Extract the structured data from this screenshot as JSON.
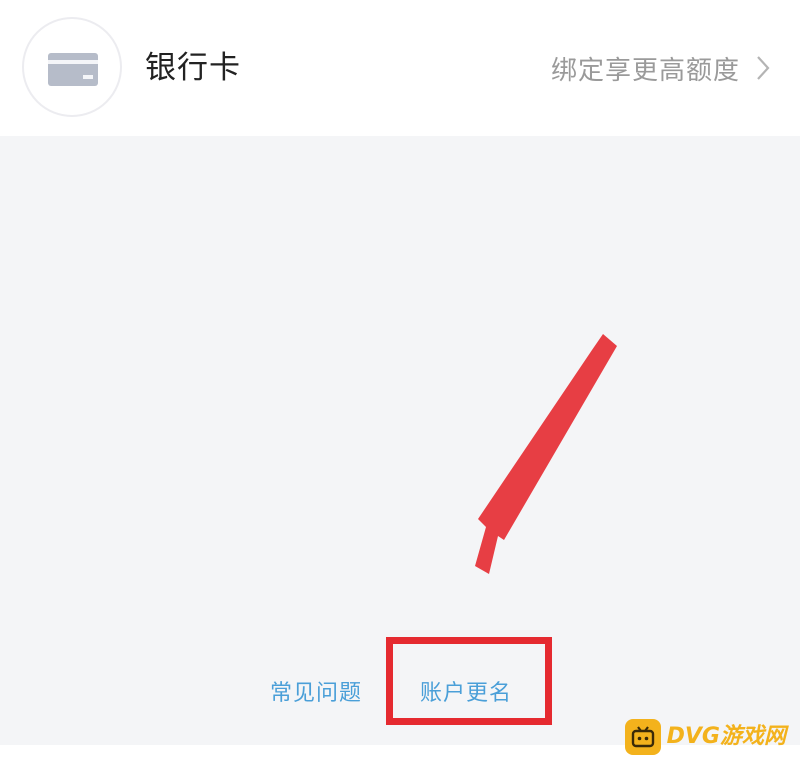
{
  "bank_card_row": {
    "title": "银行卡",
    "action_label": "绑定享更高额度",
    "icon": "bank-card-icon",
    "chevron_icon": "chevron-right-icon"
  },
  "footer_links": {
    "faq": "常见问题",
    "rename_account": "账户更名"
  },
  "annotation": {
    "arrow_color": "#e52a30",
    "highlight_color": "#e52a30"
  },
  "watermark": {
    "text": "DVG游戏网"
  },
  "colors": {
    "page_background": "#f4f5f7",
    "link": "#4a9fd8",
    "watermark": "#f3b21c"
  }
}
